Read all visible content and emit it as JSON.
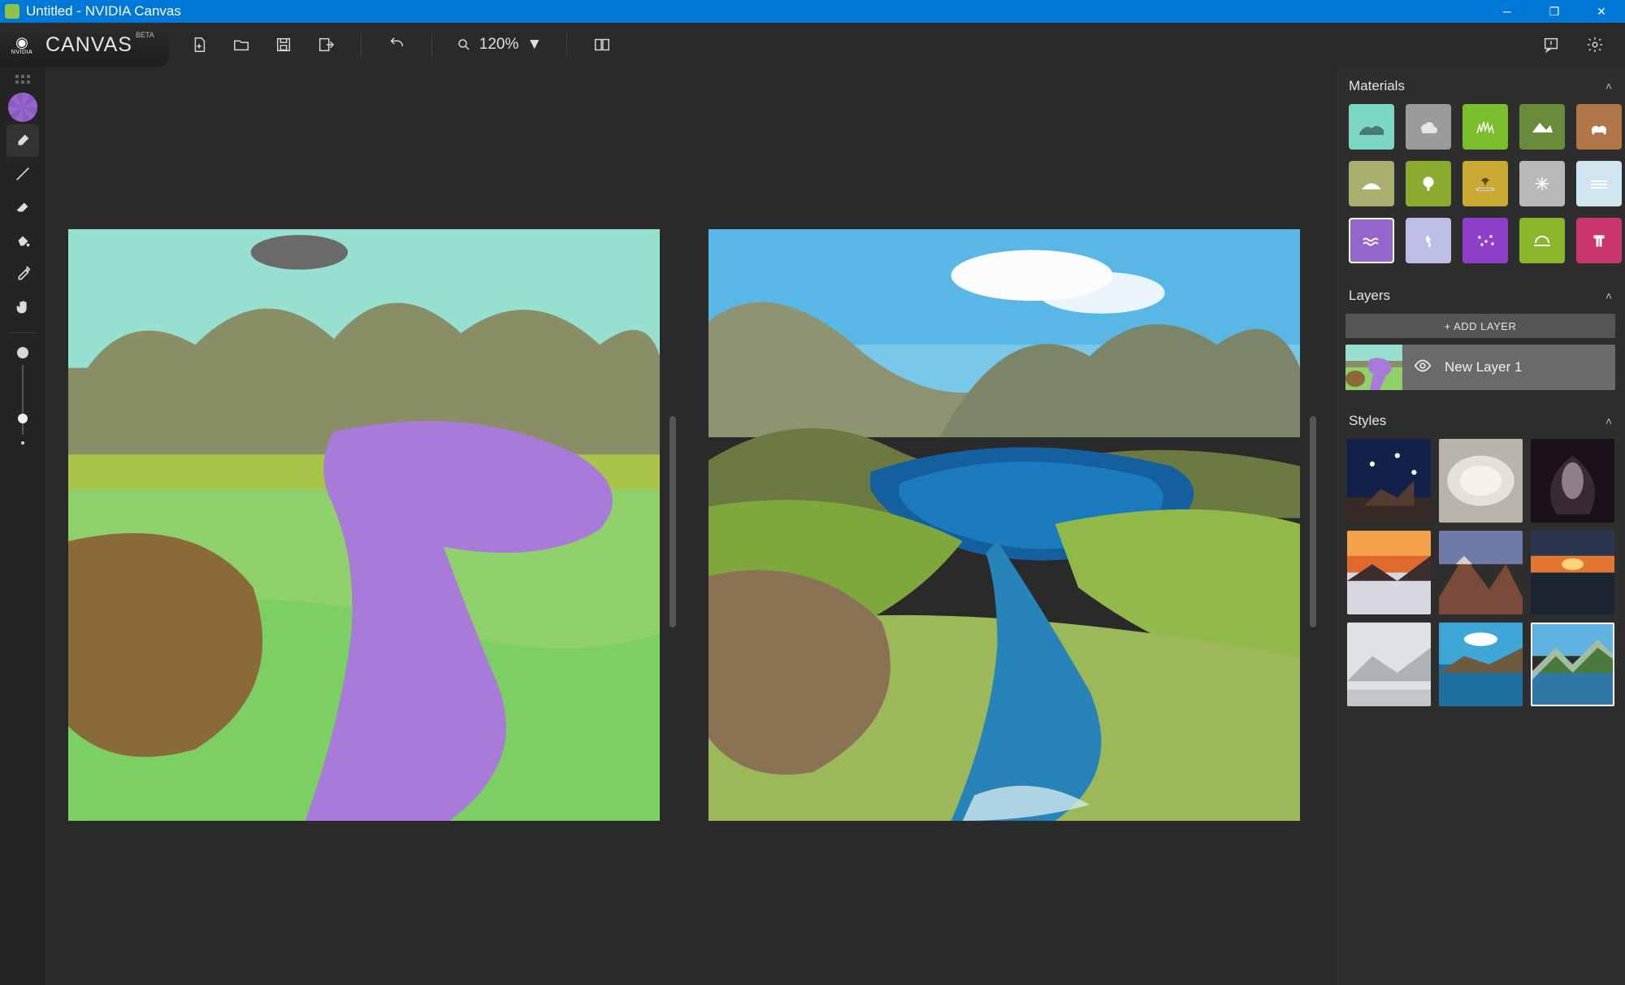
{
  "window": {
    "title": "Untitled - NVIDIA Canvas"
  },
  "brand": {
    "name": "CANVAS",
    "badge": "BETA",
    "vendor": "NVIDIA"
  },
  "toolbar": {
    "zoom_label": "120%",
    "buttons": {
      "new": "New",
      "open": "Open",
      "save": "Save",
      "export": "Export",
      "undo": "Undo",
      "compare": "Compare",
      "feedback": "Feedback",
      "settings": "Settings"
    }
  },
  "tools": [
    {
      "id": "material-wheel",
      "label": "Material"
    },
    {
      "id": "brush",
      "label": "Brush"
    },
    {
      "id": "line",
      "label": "Line"
    },
    {
      "id": "eraser",
      "label": "Eraser"
    },
    {
      "id": "fill",
      "label": "Fill"
    },
    {
      "id": "eyedropper",
      "label": "Eyedropper"
    },
    {
      "id": "pan",
      "label": "Pan"
    }
  ],
  "panels": {
    "materials": {
      "title": "Materials",
      "items": [
        {
          "id": "sky",
          "color": "#7bd6c2"
        },
        {
          "id": "cloud",
          "color": "#9b9b9b"
        },
        {
          "id": "grass",
          "color": "#7cbf2c"
        },
        {
          "id": "mountain",
          "color": "#6a8a3c"
        },
        {
          "id": "dirt",
          "color": "#b07748"
        },
        {
          "id": "hill",
          "color": "#a9b06e"
        },
        {
          "id": "tree",
          "color": "#8aab2f"
        },
        {
          "id": "bush",
          "color": "#c9a932"
        },
        {
          "id": "snow",
          "color": "#b8b8b8"
        },
        {
          "id": "fog",
          "color": "#cfe5ef"
        },
        {
          "id": "sea",
          "color": "#9766cc",
          "selected": true
        },
        {
          "id": "river",
          "color": "#bcbee6"
        },
        {
          "id": "stars",
          "color": "#8e3fc9"
        },
        {
          "id": "wetland",
          "color": "#8bb52b"
        },
        {
          "id": "building",
          "color": "#c9366c"
        }
      ]
    },
    "layers": {
      "title": "Layers",
      "add_label": "+ ADD LAYER",
      "items": [
        {
          "name": "New Layer 1",
          "visible": true
        }
      ]
    },
    "styles": {
      "title": "Styles",
      "items": [
        {
          "id": "style-1"
        },
        {
          "id": "style-2"
        },
        {
          "id": "style-3"
        },
        {
          "id": "style-4"
        },
        {
          "id": "style-5"
        },
        {
          "id": "style-6"
        },
        {
          "id": "style-7"
        },
        {
          "id": "style-8"
        },
        {
          "id": "style-9",
          "selected": true
        }
      ]
    }
  }
}
